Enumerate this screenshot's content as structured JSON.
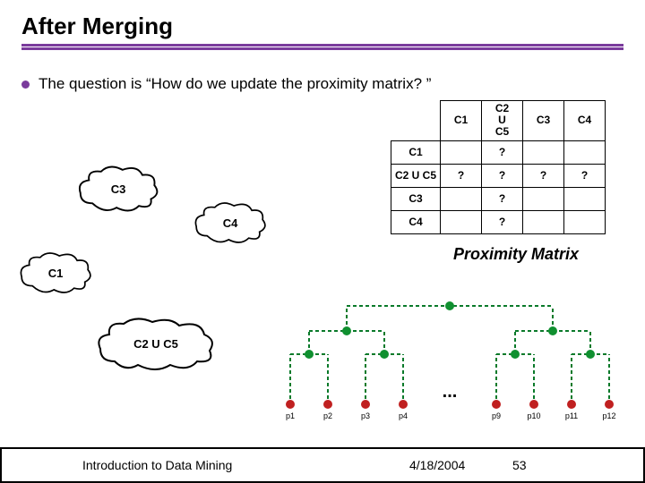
{
  "title": "After Merging",
  "bullet": "The question is “How do we update the proximity matrix? ”",
  "clusters": {
    "c1": "C1",
    "c3": "C3",
    "c4": "C4",
    "c2u5": "C2 U C5"
  },
  "matrix": {
    "col_headers": [
      "C1",
      "C2\nU\nC5",
      "C3",
      "C4"
    ],
    "row_headers": [
      "C1",
      "C2 U C5",
      "C3",
      "C4"
    ],
    "cells": [
      [
        "",
        "?",
        "",
        ""
      ],
      [
        "?",
        "?",
        "?",
        "?"
      ],
      [
        "",
        "?",
        "",
        ""
      ],
      [
        "",
        "?",
        "",
        ""
      ]
    ],
    "caption": "Proximity Matrix"
  },
  "dendrogram": {
    "leaf_labels": [
      "p1",
      "p2",
      "p3",
      "p4",
      "p9",
      "p10",
      "p11",
      "p12"
    ],
    "ellipsis": "..."
  },
  "footer": {
    "left": "Introduction to Data Mining",
    "date": "4/18/2004",
    "page": "53"
  }
}
